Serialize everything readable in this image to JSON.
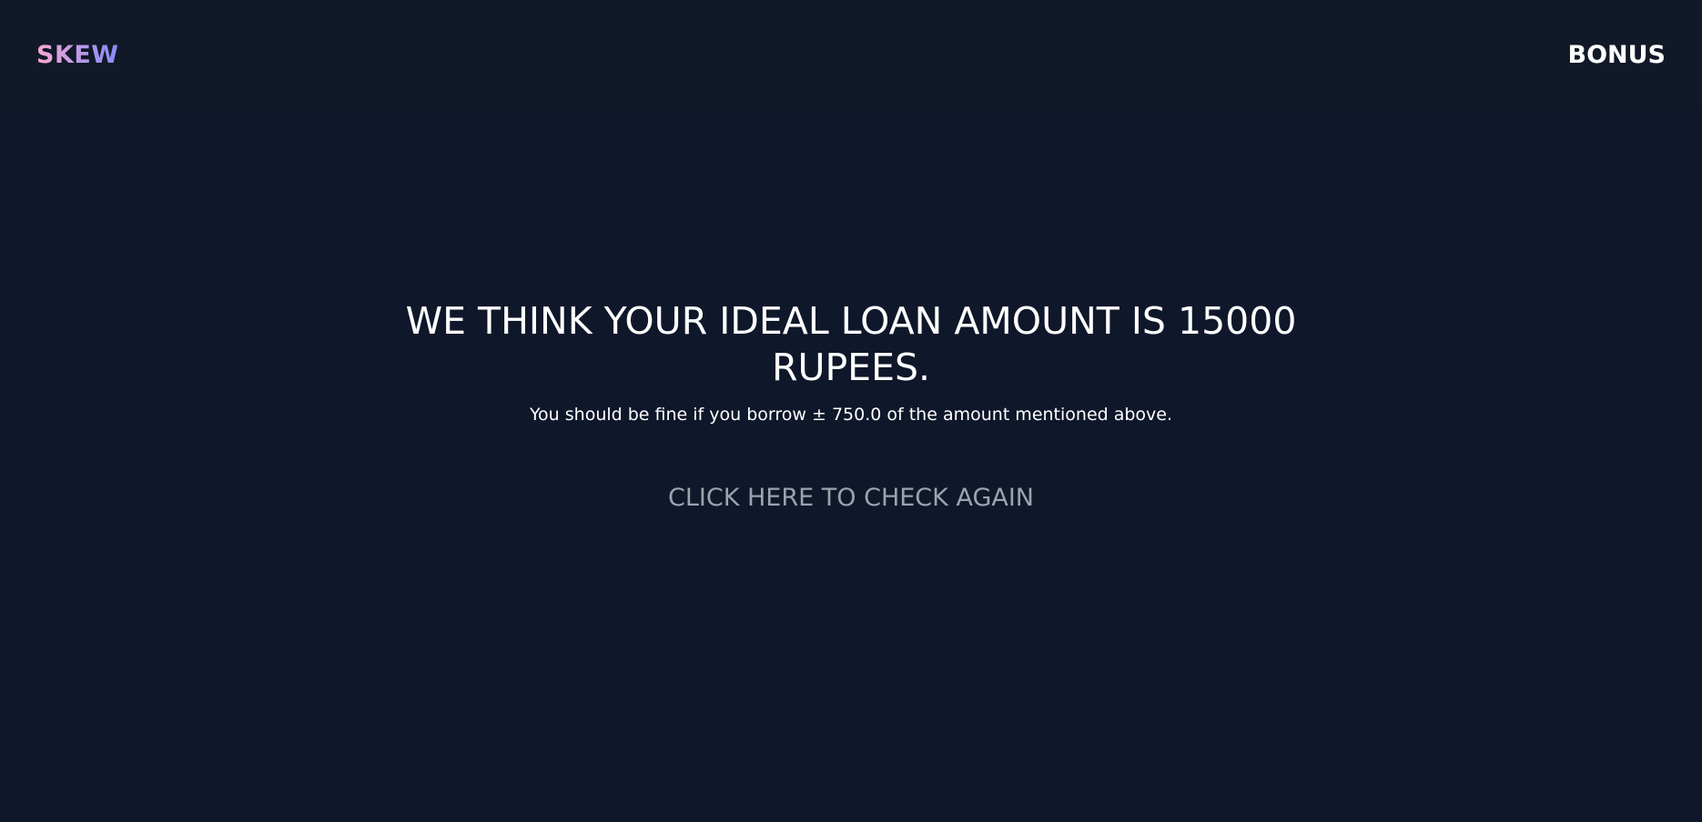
{
  "header": {
    "brand": "SKEW",
    "nav_link": "BONUS"
  },
  "result": {
    "headline": "WE THINK YOUR IDEAL LOAN AMOUNT IS 15000 RUPEES.",
    "subtext": "You should be fine if you borrow ± 750.0 of the amount mentioned above.",
    "cta_label": "CLICK HERE TO CHECK AGAIN"
  },
  "colors": {
    "background": "#0f172a",
    "header_background": "#111827",
    "brand_gradient_start": "#f9a8d4",
    "brand_gradient_end": "#818cf8",
    "text_primary": "#ffffff",
    "cta_text": "#9ca3af"
  }
}
